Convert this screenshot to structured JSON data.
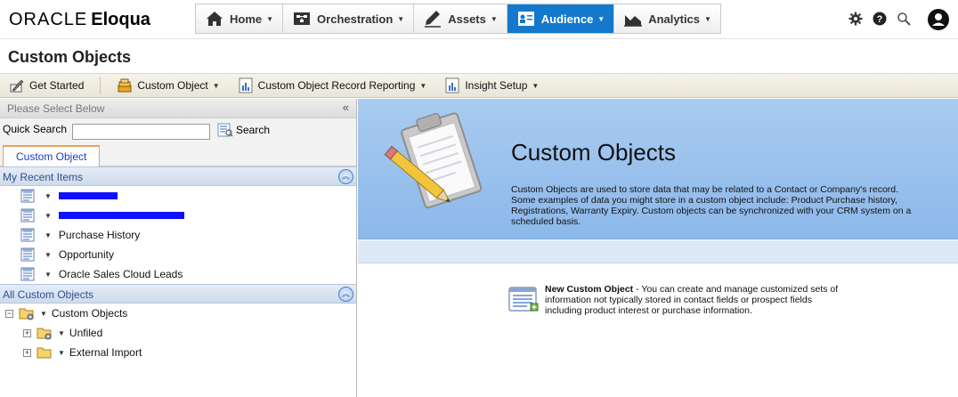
{
  "brand": {
    "part1": "ORACLE",
    "part2": "Eloqua"
  },
  "nav": [
    {
      "label": "Home",
      "icon": "house-icon"
    },
    {
      "label": "Orchestration",
      "icon": "orchestration-icon"
    },
    {
      "label": "Assets",
      "icon": "pencil-icon"
    },
    {
      "label": "Audience",
      "icon": "contact-card-icon",
      "active": true
    },
    {
      "label": "Analytics",
      "icon": "chart-icon"
    }
  ],
  "utility_icons": [
    "gear-icon",
    "help-icon",
    "search-icon",
    "user-avatar-icon"
  ],
  "page_title": "Custom Objects",
  "toolbar": {
    "get_started": "Get Started",
    "custom_object": "Custom Object",
    "record_reporting": "Custom Object Record Reporting",
    "insight_setup": "Insight Setup"
  },
  "left_panel": {
    "header": "Please Select Below",
    "quick_search_label": "Quick Search",
    "quick_search_value": "",
    "search_button": "Search",
    "tab": "Custom Object",
    "recent_section": "My Recent Items",
    "recent_items": [
      "Purchase History",
      "Opportunity",
      "Oracle Sales Cloud Leads"
    ],
    "all_section": "All Custom Objects",
    "tree": {
      "root": "Custom Objects",
      "children": [
        "Unfiled",
        "External Import"
      ]
    }
  },
  "right_panel": {
    "hero_title": "Custom Objects",
    "hero_description": "Custom Objects are used to store data that may be related to a Contact or Company's record. Some examples of data you might store in a custom object include: Product Purchase history, Registrations, Warranty Expiry. Custom objects can be synchronized with your CRM system on a scheduled basis.",
    "new_object_title": "New Custom Object",
    "new_object_description": " - You can create and manage customized sets of information not typically stored in contact fields or prospect fields including product interest or purchase information."
  },
  "colors": {
    "active_nav": "#1479cc",
    "hero_bg": "#9cc2ec",
    "redaction": "#1010ff",
    "tab_border": "#e8a15a"
  }
}
